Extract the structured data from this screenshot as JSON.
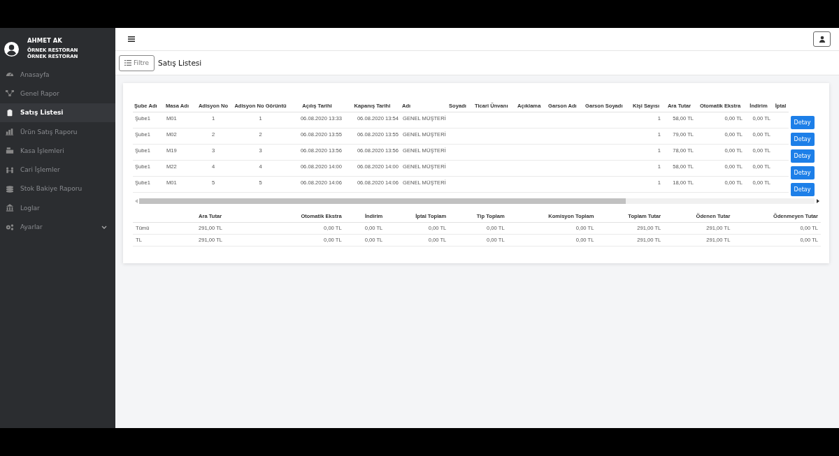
{
  "user": {
    "name": "AHMET AK",
    "lines": [
      "ÖRNEK RESTORAN",
      "ÖRNEK RESTORAN"
    ]
  },
  "sidebar": {
    "items": [
      {
        "label": "Anasayfa",
        "selected": false
      },
      {
        "label": "Genel Rapor",
        "selected": false
      },
      {
        "label": "Satış Listesi",
        "selected": true
      },
      {
        "label": "Ürün Satış Raporu",
        "selected": false
      },
      {
        "label": "Kasa İşlemleri",
        "selected": false
      },
      {
        "label": "Cari İşlemler",
        "selected": false
      },
      {
        "label": "Stok Bakiye Raporu",
        "selected": false
      },
      {
        "label": "Loglar",
        "selected": false
      },
      {
        "label": "Ayarlar",
        "selected": false,
        "expandable": true
      }
    ]
  },
  "toolbar": {
    "filter_button": "Filtre",
    "title": "Satış Listesi"
  },
  "table": {
    "columns": [
      "Şube Adı",
      "Masa Adı",
      "Adisyon No",
      "Adisyon No Görüntü",
      "Açılış Tarihi",
      "Kapanış Tarihi",
      "Adı",
      "Soyadı",
      "Ticari Ünvanı",
      "Açıklama",
      "Garson Adı",
      "Garson Soyadı",
      "Kişi Sayısı",
      "Ara Tutar",
      "Otomatik Ekstra",
      "İndirim",
      "İptal"
    ],
    "rows": [
      {
        "cells": [
          "Şube1",
          "M01",
          "1",
          "1",
          "06.08.2020 13:33",
          "06.08.2020 13:54",
          "GENEL MÜŞTERİ",
          "",
          "",
          "",
          "",
          "",
          "1",
          "58,00 TL",
          "0,00 TL",
          "0,00 TL",
          ""
        ],
        "button": "Detay"
      },
      {
        "cells": [
          "Şube1",
          "M02",
          "2",
          "2",
          "06.08.2020 13:55",
          "06.08.2020 13:55",
          "GENEL MÜŞTERİ",
          "",
          "",
          "",
          "",
          "",
          "1",
          "79,00 TL",
          "0,00 TL",
          "0,00 TL",
          ""
        ],
        "button": "Detay"
      },
      {
        "cells": [
          "Şube1",
          "M19",
          "3",
          "3",
          "06.08.2020 13:56",
          "06.08.2020 13:56",
          "GENEL MÜŞTERİ",
          "",
          "",
          "",
          "",
          "",
          "1",
          "78,00 TL",
          "0,00 TL",
          "0,00 TL",
          ""
        ],
        "button": "Detay"
      },
      {
        "cells": [
          "Şube1",
          "M22",
          "4",
          "4",
          "06.08.2020 14:00",
          "06.08.2020 14:00",
          "GENEL MÜŞTERİ",
          "",
          "",
          "",
          "",
          "",
          "1",
          "58,00 TL",
          "0,00 TL",
          "0,00 TL",
          ""
        ],
        "button": "Detay"
      },
      {
        "cells": [
          "Şube1",
          "M01",
          "5",
          "5",
          "06.08.2020 14:06",
          "06.08.2020 14:06",
          "GENEL MÜŞTERİ",
          "",
          "",
          "",
          "",
          "",
          "1",
          "18,00 TL",
          "0,00 TL",
          "0,00 TL",
          ""
        ],
        "button": "Detay"
      }
    ]
  },
  "summary": {
    "columns": [
      "Ara Tutar",
      "Otomatik Ekstra",
      "İndirim",
      "İptal Toplam",
      "Tip Toplam",
      "Komisyon Toplam",
      "Toplam Tutar",
      "Ödenen Tutar",
      "Ödenmeyen Tutar"
    ],
    "rows": [
      {
        "label": "Tümü",
        "cells": [
          "291,00 TL",
          "0,00 TL",
          "0,00 TL",
          "0,00 TL",
          "0,00 TL",
          "0,00 TL",
          "291,00 TL",
          "291,00 TL",
          "0,00 TL"
        ]
      },
      {
        "label": "TL",
        "cells": [
          "291,00 TL",
          "0,00 TL",
          "0,00 TL",
          "0,00 TL",
          "0,00 TL",
          "0,00 TL",
          "291,00 TL",
          "291,00 TL",
          "0,00 TL"
        ]
      }
    ]
  }
}
